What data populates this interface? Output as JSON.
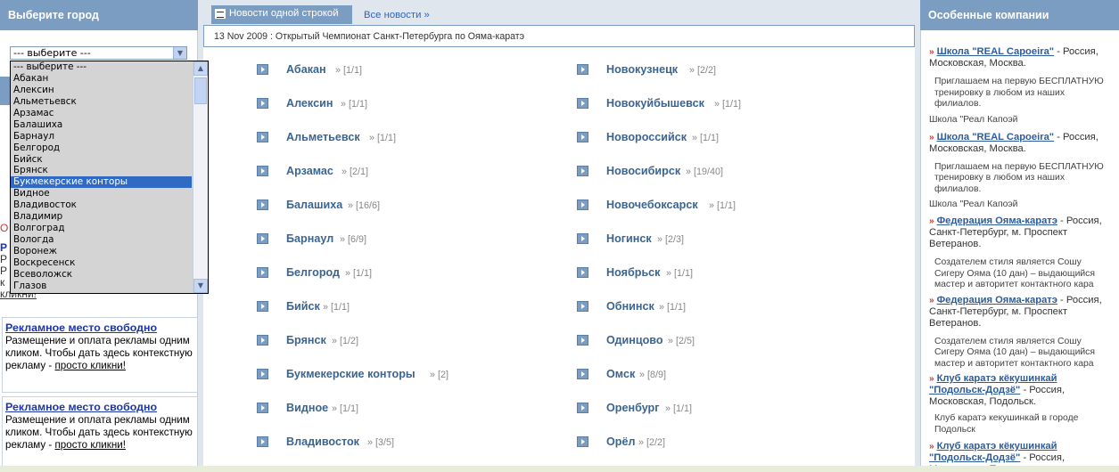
{
  "left": {
    "header": "Выберите город",
    "select_value": "--- выберите ---",
    "options": [
      "--- выберите ---",
      "Абакан",
      "Алексин",
      "Альметьевск",
      "Арзамас",
      "Балашиха",
      "Барнаул",
      "Белгород",
      "Бийск",
      "Брянск",
      "Букмекерские конторы",
      "Видное",
      "Владивосток",
      "Владимир",
      "Волгоград",
      "Вологда",
      "Воронеж",
      "Воскресенск",
      "Всеволожск",
      "Глазов"
    ],
    "selected_option": "Букмекерские конторы",
    "partial_ad": [
      "О",
      "Р",
      "Р",
      "Р",
      "к",
      "кликни!"
    ],
    "ads": [
      {
        "title": "Рекламное место свободно",
        "text": "Размещение и оплата рекламы одним кликом. Чтобы дать здесь контекстную рекламу - ",
        "link": "просто кликни!"
      },
      {
        "title": "Рекламное место свободно",
        "text": "Размещение и оплата рекламы одним кликом. Чтобы дать здесь контекстную рекламу - ",
        "link": "просто кликни!"
      }
    ]
  },
  "center": {
    "tab_active": "Новости одной строкой",
    "tab_all": "Все новости »",
    "news": {
      "date": "13 Nov 2009",
      "text": " : Открытый Чемпионат Санкт-Петербурга по Ояма-каратэ"
    },
    "cities_left": [
      {
        "name": "Абакан",
        "count": "» [1/1]"
      },
      {
        "name": "Алексин",
        "count": "» [1/1]"
      },
      {
        "name": "Альметьевск",
        "count": "» [1/1]"
      },
      {
        "name": "Арзамас",
        "count": "» [2/1]"
      },
      {
        "name": "Балашиха",
        "count": "» [16/6]"
      },
      {
        "name": "Барнаул",
        "count": "» [6/9]"
      },
      {
        "name": "Белгород",
        "count": "» [1/1]"
      },
      {
        "name": "Бийск",
        "count": "» [1/1]"
      },
      {
        "name": "Брянск",
        "count": "» [1/2]"
      },
      {
        "name": "Букмекерские конторы",
        "count": "» [2]"
      },
      {
        "name": "Видное",
        "count": "» [1/1]"
      },
      {
        "name": "Владивосток",
        "count": "» [3/5]"
      }
    ],
    "cities_right": [
      {
        "name": "Новокузнецк",
        "count": "» [2/2]"
      },
      {
        "name": "Новокуйбышевск",
        "count": "» [1/1]"
      },
      {
        "name": "Новороссийск",
        "count": "» [1/1]"
      },
      {
        "name": "Новосибирск",
        "count": "» [19/40]"
      },
      {
        "name": "Новочебоксарск",
        "count": "» [1/1]"
      },
      {
        "name": "Ногинск",
        "count": "» [2/3]"
      },
      {
        "name": "Ноябрьск",
        "count": "» [1/1]"
      },
      {
        "name": "Обнинск",
        "count": "» [1/1]"
      },
      {
        "name": "Одинцово",
        "count": "» [2/5]"
      },
      {
        "name": "Омск",
        "count": "» [8/9]"
      },
      {
        "name": "Оренбург",
        "count": "» [1/1]"
      },
      {
        "name": "Орёл",
        "count": "» [2/2]"
      }
    ]
  },
  "right": {
    "header": "Особенные компании",
    "items": [
      {
        "name": "Школа \"REAL Capoeira\"",
        "loc": " - Россия, Московская, Москва.",
        "desc": "Приглашаем на первую БЕСПЛАТНУЮ тренировку в любом из наших филиалов.",
        "sub": "Школа \"Реал Капоэй"
      },
      {
        "name": "Школа \"REAL Capoeira\"",
        "loc": " - Россия, Московская, Москва.",
        "desc": "Приглашаем на первую БЕСПЛАТНУЮ тренировку в любом из наших филиалов.",
        "sub": "Школа \"Реал Капоэй"
      },
      {
        "name": "Федерация Ояма-каратэ",
        "loc": " - Россия, Санкт-Петербург, м. Проспект Ветеранов.",
        "desc": "Создателем стиля является Сошу Сигеру Ояма (10 дан) – выдающийся мастер и авторитет контактного кара",
        "sub": ""
      },
      {
        "name": "Федерация Ояма-каратэ",
        "loc": " - Россия, Санкт-Петербург, м. Проспект Ветеранов.",
        "desc": "Создателем стиля является Сошу Сигеру Ояма (10 дан) – выдающийся мастер и авторитет контактного кара",
        "sub": ""
      },
      {
        "name": "Клуб каратэ кёкушинкай \"Подольск-Додзё\"",
        "loc": " - Россия, Московская, Подольск.",
        "desc": "Клуб каратэ кекушинкай в городе Подольск",
        "sub": ""
      },
      {
        "name": "Клуб каратэ кёкушинкай \"Подольск-Додзё\"",
        "loc": " - Россия, Московская, Подольск.",
        "desc": "",
        "sub": ""
      }
    ]
  }
}
